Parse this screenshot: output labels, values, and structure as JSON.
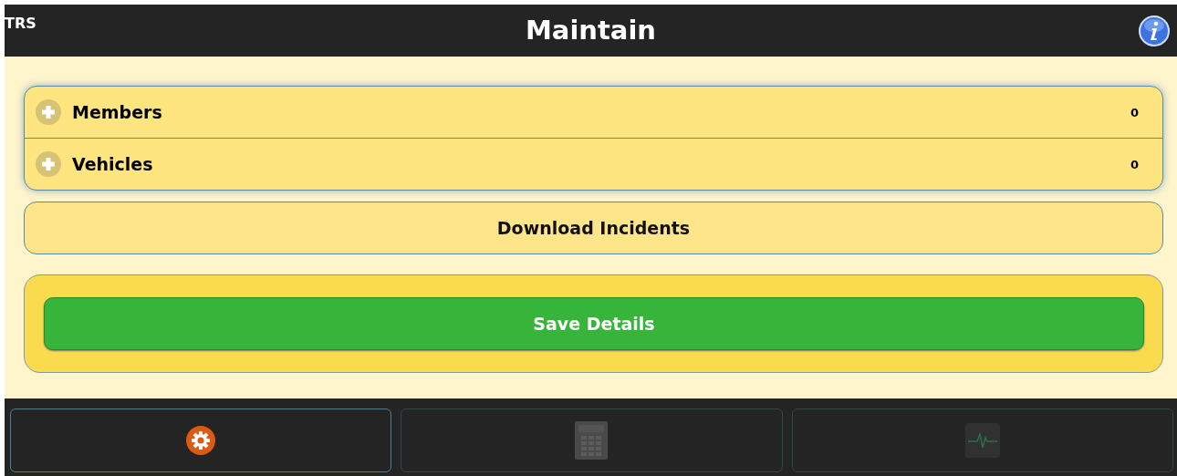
{
  "header": {
    "brand": "TRS",
    "title": "Maintain"
  },
  "sections": [
    {
      "label": "Members",
      "count": "0",
      "expanded": false
    },
    {
      "label": "Vehicles",
      "count": "0",
      "expanded": false
    }
  ],
  "download_button": "Download Incidents",
  "save_button": "Save Details",
  "tabs": [
    {
      "kind": "settings",
      "selected": true
    },
    {
      "kind": "calculator",
      "selected": false
    },
    {
      "kind": "monitor",
      "selected": false
    }
  ]
}
